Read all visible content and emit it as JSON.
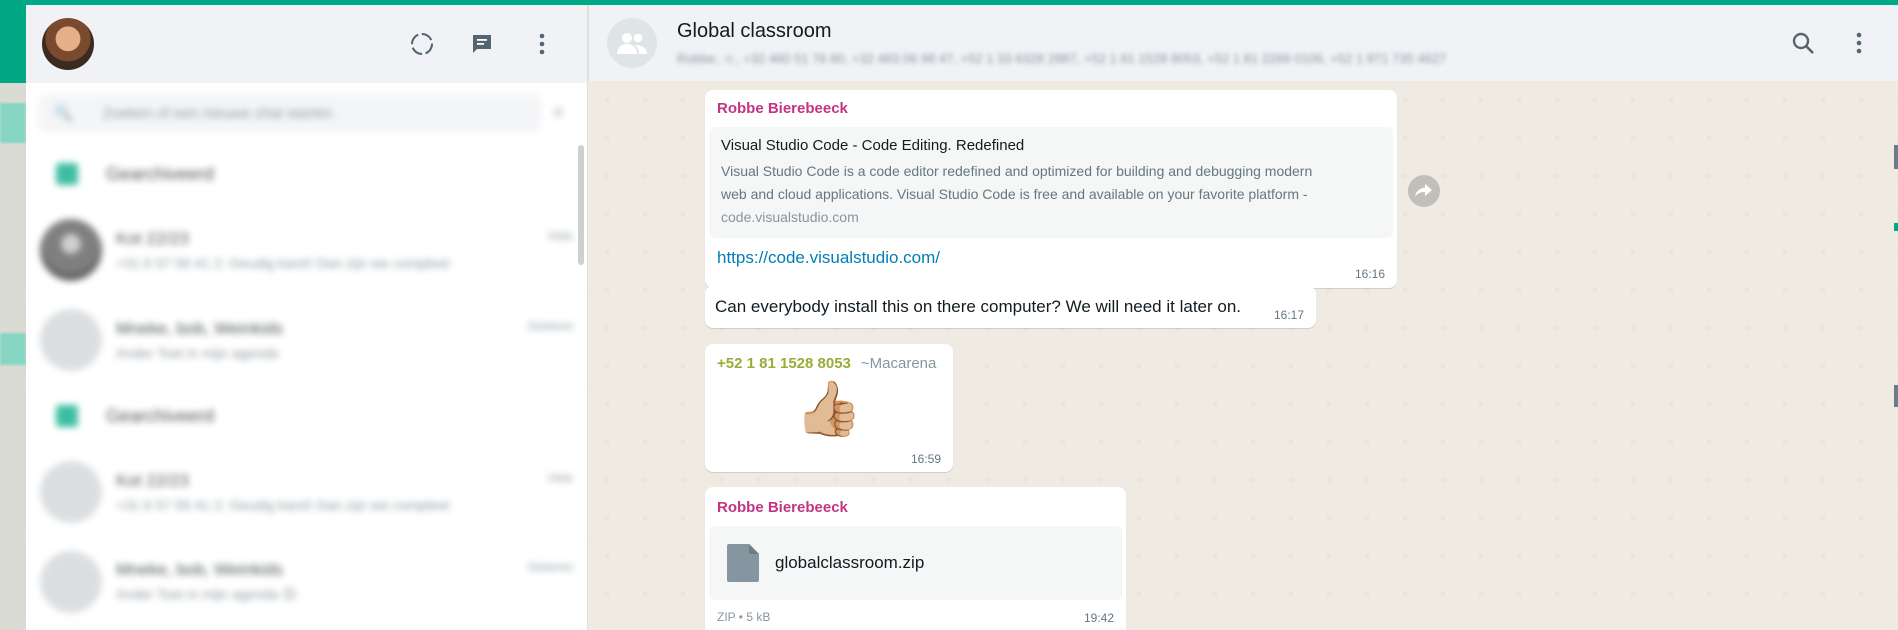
{
  "sidebar": {
    "search_placeholder": "Zoeken of een nieuwe chat starten",
    "archived_label": "Gearchiveerd",
    "chats": [
      {
        "name": "Kot 22/23",
        "time": "Hele",
        "preview": "+31 6 57 59 41 2: Geudig kanö! Dan zijn we compleet"
      },
      {
        "name": "Mneke, bob, Weinkids",
        "time": "Gisteren",
        "preview": "Ander Toet in mijn agenda"
      }
    ],
    "archived_label_2": "Gearchiveerd",
    "chats_2": [
      {
        "name": "Kot 22/23",
        "time": "Hele",
        "preview": "+31 6 57 59 41 2: Geudig kanö! Dan zijn we compleet"
      },
      {
        "name": "Mneke, bob, Weinkids",
        "time": "Gisteren",
        "preview": "Ander Toet in mijn agenda 😊"
      }
    ]
  },
  "conversation": {
    "title": "Global classroom",
    "participants": "Robbe, ☺, +32 460 51 76 80, +32 483 06 98 47, +52 1 33 6328 2887, +52 1 81 1528 8053, +52 1 81 2289 0106, +52 1 871 735 4627",
    "messages": {
      "m1": {
        "sender": "Robbe Bierebeeck",
        "preview_title": "Visual Studio Code - Code Editing. Redefined",
        "preview_desc_1": "Visual Studio Code is a code editor redefined and optimized for building and debugging modern",
        "preview_desc_2": "web and cloud applications.  Visual Studio Code is free and available on your favorite platform -",
        "preview_domain": "code.visualstudio.com",
        "link": "https://code.visualstudio.com/",
        "time": "16:16"
      },
      "m2": {
        "text": "Can everybody install this on there computer? We will need it later on.",
        "time": "16:17"
      },
      "m3": {
        "sender": "+52 1 81 1528 8053",
        "alias": "~Macarena",
        "emoji": "👍🏼",
        "time": "16:59"
      },
      "m4": {
        "sender": "Robbe Bierebeeck",
        "file_name": "globalclassroom.zip",
        "file_type": "ZIP",
        "file_size": "5 kB",
        "time": "19:42"
      }
    }
  },
  "colors": {
    "accent": "#00a884",
    "sender_pink": "#c13584",
    "sender_olive": "#9aab37",
    "link": "#027eb5"
  },
  "icons": [
    "status-icon",
    "new-chat-icon",
    "menu-icon",
    "search-icon",
    "filter-icon",
    "archive-icon",
    "group-icon",
    "forward-icon",
    "file-icon"
  ]
}
